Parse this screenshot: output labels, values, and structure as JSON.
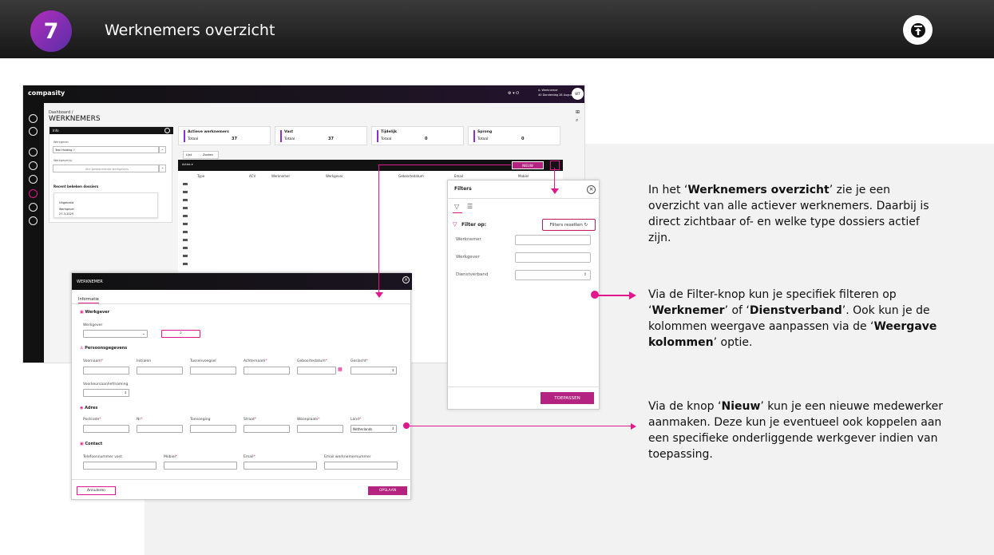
{
  "header": {
    "step": "7",
    "title": "Werknemers overzicht"
  },
  "app": {
    "logo": "compasity",
    "user_name": "A. Werknemer",
    "user_date": "40 Donderdag 28 Augustus",
    "avatar": "WT",
    "breadcrumb": "Dashboard /",
    "page_title": "WERKNEMERS",
    "info": {
      "title": "Info",
      "werkgever_label": "Werkgever",
      "werkgever_value": "Test Holding ✓",
      "werkgever2_label": "Werkgever(s)",
      "werkgever2_placeholder": "Alle geselecteerde werkgevers",
      "recent_title": "Recent bekeken dossiers",
      "recent_type": "Uitgebreid",
      "recent_name": "Werkgever",
      "recent_date": "27-3-2025"
    },
    "cards": [
      {
        "title": "Actieve werknemers",
        "label": "Totaal",
        "value": "37"
      },
      {
        "title": "Vast",
        "label": "Totaal",
        "value": "37"
      },
      {
        "title": "Tijdelijk",
        "label": "Totaal",
        "value": "0"
      },
      {
        "title": "Sprong",
        "label": "Totaal",
        "value": "0"
      }
    ],
    "tabs": [
      "Lijst",
      "Zoeken"
    ],
    "table_toolbar": "Acties ▾",
    "nieuw_label": "NIEUW",
    "columns": [
      "Type",
      "ACV",
      "Werknemer",
      "Werkgever",
      "Geboortedatum",
      "Email",
      "Mobiel"
    ]
  },
  "filters": {
    "title": "Filters",
    "filter_op": "Filter op:",
    "reset": "Filters resetten",
    "fields": [
      "Werknemer",
      "Werkgever",
      "Dienstverband"
    ],
    "apply": "TOEPASSEN"
  },
  "modal": {
    "title": "WERKNEMER",
    "tab": "Informatie",
    "werkgever_section": "Werkgever",
    "werkgever_label": "Werkgever",
    "persons_section": "Persoonsgegevens",
    "persons_fields": [
      "Voornaam",
      "Initialen",
      "Tussenvoegsel",
      "Achternaam",
      "Geboortedatum",
      "Geslacht"
    ],
    "voorkeur_label": "Voorkeursaanhef/naming",
    "adres_section": "Adres",
    "adres_fields": [
      "Postcode",
      "Nr",
      "Toevoeging",
      "Straat",
      "Woonplaats",
      "Land"
    ],
    "land_value": "Netherlands",
    "contact_section": "Contact",
    "contact_fields": [
      "Telefoonnummer vast",
      "Mobiel",
      "Email",
      "Email werknemernummer"
    ],
    "cancel": "Annuleren",
    "save": "OPSLAAN"
  },
  "notes": {
    "p1": [
      "In het ‘",
      "Werknemers overzicht",
      "’ zie je een overzicht van alle actiever werknemers. Daarbij is direct zichtbaar of- en welke type dossiers actief zijn."
    ],
    "p2": [
      "Via de Filter-knop kun je specifiek filteren op ‘",
      "Werknemer",
      "’ of ‘",
      "Dienstverband",
      "’. Ook kun je de kolommen weergave aanpassen via de ‘",
      "Weergave kolommen",
      "’ optie."
    ],
    "p3": [
      "Via de knop ‘",
      "Nieuw",
      "’ kun je een nieuwe medewerker aanmaken. Deze kun je eventueel ook koppelen aan een specifieke onderliggende werkgever indien van toepassing."
    ]
  },
  "colors": {
    "accent": "#e0188c",
    "brand_purple": "#8d2fd5"
  }
}
